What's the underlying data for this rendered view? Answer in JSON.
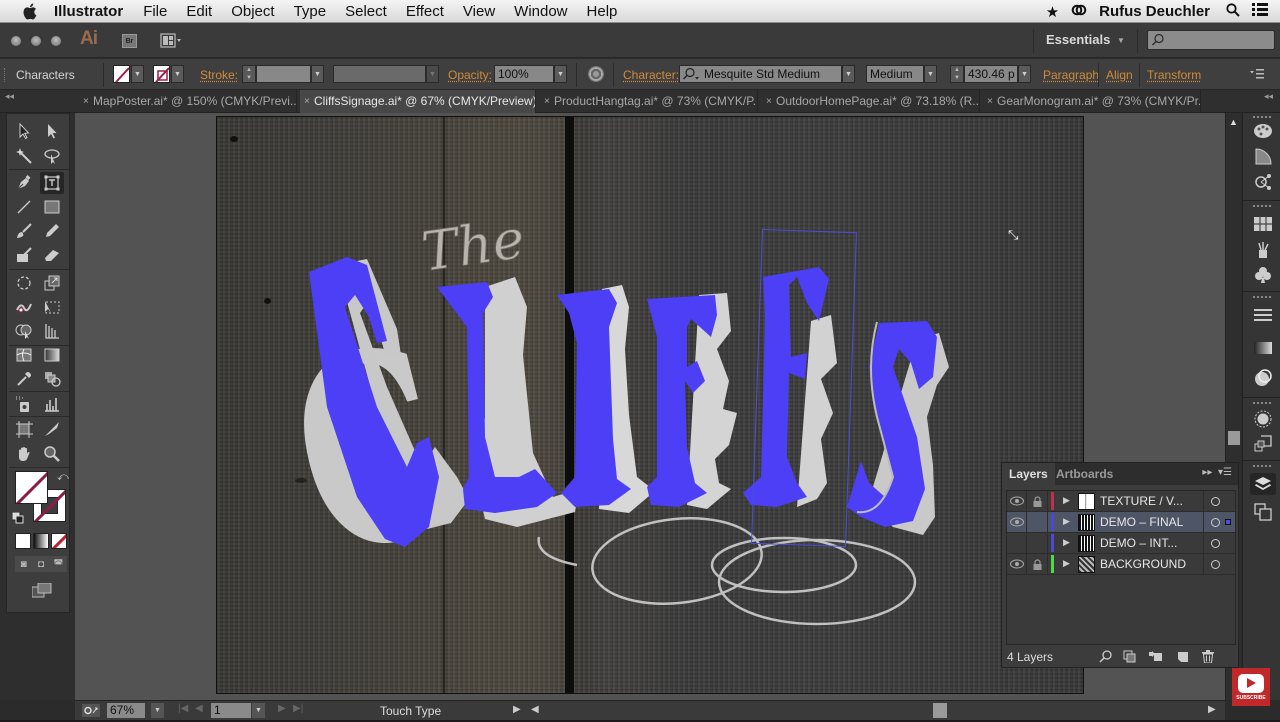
{
  "menubar": {
    "app_name": "Illustrator",
    "items": [
      "File",
      "Edit",
      "Object",
      "Type",
      "Select",
      "Effect",
      "View",
      "Window",
      "Help"
    ],
    "user": "Rufus Deuchler",
    "icons": [
      "apple-icon",
      "star-icon",
      "creative-cloud-icon",
      "spotlight-search-icon",
      "notification-list-icon"
    ]
  },
  "appbar": {
    "logo": "Ai",
    "bridge_label": "Br",
    "workspace": "Essentials",
    "search_placeholder": ""
  },
  "controlbar": {
    "selection_type": "Characters",
    "stroke_label": "Stroke:",
    "stroke_value": "",
    "opacity_label": "Opacity:",
    "opacity_value": "100%",
    "character_label": "Character:",
    "font_family": "Mesquite Std Medium",
    "font_style": "Medium",
    "font_size": "430.46 p",
    "paragraph_link": "Paragraph",
    "align_link": "Align",
    "transform_link": "Transform"
  },
  "tabs": [
    {
      "label": "MapPoster.ai* @ 150% (CMYK/Previ...",
      "active": false
    },
    {
      "label": "CliffsSignage.ai* @ 67% (CMYK/Preview)",
      "active": true
    },
    {
      "label": "ProductHangtag.ai* @ 73% (CMYK/P...",
      "active": false
    },
    {
      "label": "OutdoorHomePage.ai* @ 73.18% (R...",
      "active": false
    },
    {
      "label": "GearMonogram.ai* @ 73% (CMYK/Pr...",
      "active": false
    }
  ],
  "tab_close_glyph": "×",
  "artwork": {
    "script_word": "The",
    "main_word": "CLIFFS",
    "letter_color": "#4c3ff5",
    "shadow_color": "#c8c8c8"
  },
  "layers_panel": {
    "tabs": [
      "Layers",
      "Artboards"
    ],
    "layers": [
      {
        "name": "TEXTURE / V...",
        "visible": true,
        "locked": true,
        "color": "#c0304a",
        "selected": false
      },
      {
        "name": "DEMO – FINAL",
        "visible": true,
        "locked": false,
        "color": "#4a4ad0",
        "selected": true
      },
      {
        "name": "DEMO – INT...",
        "visible": false,
        "locked": false,
        "color": "#4a4ad0",
        "selected": false
      },
      {
        "name": "BACKGROUND",
        "visible": true,
        "locked": true,
        "color": "#4ed84a",
        "selected": false
      }
    ],
    "count": "4 Layers"
  },
  "statusbar": {
    "zoom": "67%",
    "artboard": "1",
    "current_tool": "Touch Type"
  },
  "subscribe_label": "SUBSCRIBE"
}
